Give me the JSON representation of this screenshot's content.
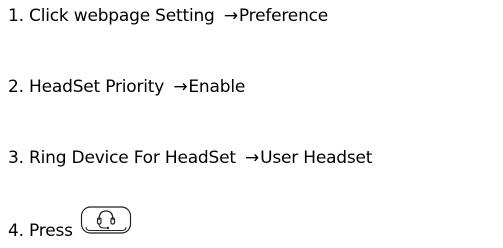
{
  "steps": [
    {
      "number": "1.",
      "text": "Click webpage Setting",
      "arrow": "→",
      "result": "Preference"
    },
    {
      "number": "2.",
      "text": "HeadSet Priority",
      "arrow": "→",
      "result": "Enable"
    },
    {
      "number": "3.",
      "text": "Ring Device For HeadSet",
      "arrow": "→",
      "result": "User Headset"
    },
    {
      "number": "4.",
      "text": "Press"
    }
  ],
  "key": {
    "icon": "headset-key-icon"
  }
}
